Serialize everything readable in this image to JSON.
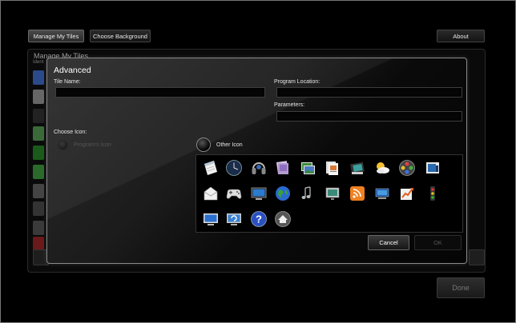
{
  "top_nav": {
    "manage_tiles": "Manage My Tiles",
    "choose_background": "Choose Background",
    "about": "About"
  },
  "background_panel": {
    "title": "Manage My Tiles",
    "subtitle": "Ident",
    "done": "Done"
  },
  "dialog": {
    "title": "Advanced",
    "tile_name_label": "Tile Name:",
    "tile_name_value": "",
    "program_location_label": "Program Location:",
    "program_location_value": "",
    "parameters_label": "Parameters:",
    "parameters_value": "",
    "choose_icon_label": "Choose Icon:",
    "program_icon_option": "Program's Icon",
    "other_icon_option": "Other Icon",
    "selected_option": "Other Icon",
    "cancel": "Cancel",
    "ok": "OK",
    "icons": [
      "calendar-icon",
      "clock-icon",
      "headphones-icon",
      "photos-icon",
      "photo-gallery-icon",
      "documents-icon",
      "film-icon",
      "weather-icon",
      "media-center-icon",
      "screen-icon",
      "mail-icon",
      "gamepad-icon",
      "monitor-icon",
      "globe-icon",
      "music-note-icon",
      "tv-icon",
      "rss-feed-icon",
      "network-icon",
      "chart-growth-icon",
      "traffic-light-icon",
      "desktop-icon",
      "backup-icon",
      "help-icon",
      "home-icon"
    ]
  },
  "colors": {
    "background": "#000000",
    "dialog_border": "#8a8a8a",
    "text": "#ffffff"
  }
}
